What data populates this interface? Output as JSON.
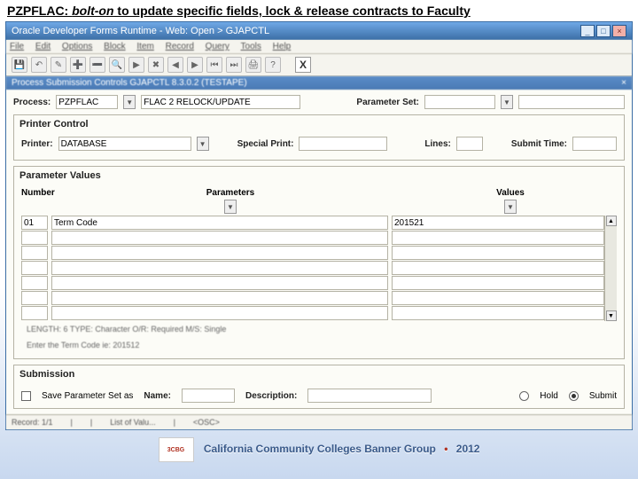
{
  "slide_title_prefix": "PZPFLAC: ",
  "slide_title_em": "bolt-on",
  "slide_title_rest": " to update specific fields, lock & release contracts to Faculty",
  "window": {
    "title": "Oracle Developer Forms Runtime - Web: Open > GJAPCTL",
    "inner_title": "Process Submission Controls  GJAPCTL  8.3.0.2  (TESTAPE)"
  },
  "menu": [
    "File",
    "Edit",
    "Options",
    "Block",
    "Item",
    "Record",
    "Query",
    "Tools",
    "Help"
  ],
  "toolbar_x": "X",
  "process": {
    "label": "Process:",
    "value": "PZPFLAC",
    "desc": "FLAC 2 RELOCK/UPDATE",
    "pset_label": "Parameter Set:",
    "pset": ""
  },
  "printer": {
    "section": "Printer Control",
    "label": "Printer:",
    "value": "DATABASE",
    "special_label": "Special Print:",
    "special": "",
    "lines_label": "Lines:",
    "lines": "",
    "submit_time_label": "Submit Time:",
    "submit_time": ""
  },
  "params": {
    "section": "Parameter Values",
    "col_number": "Number",
    "col_params": "Parameters",
    "col_values": "Values",
    "rows": [
      {
        "num": "01",
        "param": "Term Code",
        "value": "201521"
      },
      {
        "num": "",
        "param": "",
        "value": ""
      },
      {
        "num": "",
        "param": "",
        "value": ""
      },
      {
        "num": "",
        "param": "",
        "value": ""
      },
      {
        "num": "",
        "param": "",
        "value": ""
      },
      {
        "num": "",
        "param": "",
        "value": ""
      },
      {
        "num": "",
        "param": "",
        "value": ""
      }
    ],
    "meta1": "LENGTH: 6  TYPE: Character  O/R: Required  M/S: Single",
    "meta2": "Enter the Term Code ie: 201512"
  },
  "submission": {
    "section": "Submission",
    "save_chk": "Save Parameter Set as",
    "name_label": "Name:",
    "name": "",
    "desc_label": "Description:",
    "desc": "",
    "hold": "Hold",
    "submit": "Submit"
  },
  "status": {
    "record": "Record: 1/1",
    "list": "List of Valu...",
    "osc": "<OSC>"
  },
  "footer": {
    "org": "California Community Colleges Banner Group",
    "year": "2012",
    "logo": "3CBG"
  }
}
